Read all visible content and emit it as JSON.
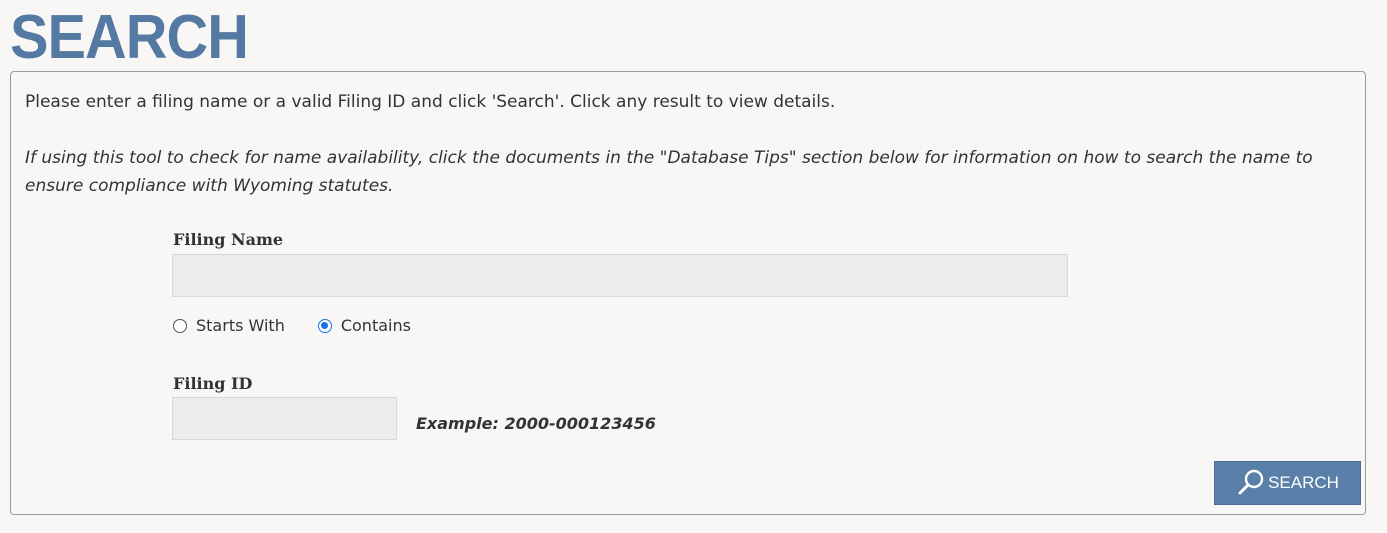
{
  "page": {
    "title": "SEARCH"
  },
  "panel": {
    "instructions": "Please enter a filing name or a valid Filing ID and click 'Search'. Click any result to view details.",
    "tip": "If using this tool to check for name availability, click the documents in the \"Database Tips\" section below for information on how to search the name to ensure compliance with Wyoming statutes."
  },
  "form": {
    "filing_name": {
      "label": "Filing Name",
      "value": "",
      "placeholder": ""
    },
    "match_options": [
      {
        "label": "Starts With",
        "selected": false
      },
      {
        "label": "Contains",
        "selected": true
      }
    ],
    "filing_id": {
      "label": "Filing ID",
      "value": "",
      "placeholder": "",
      "example": "Example: 2000-000123456"
    },
    "search_button": {
      "label": "SEARCH",
      "icon": "search-icon"
    }
  },
  "colors": {
    "title": "#5479a3",
    "button_bg": "#5a7fa8",
    "radio_selected": "#1a73e8",
    "page_bg": "#f8f7f5"
  }
}
